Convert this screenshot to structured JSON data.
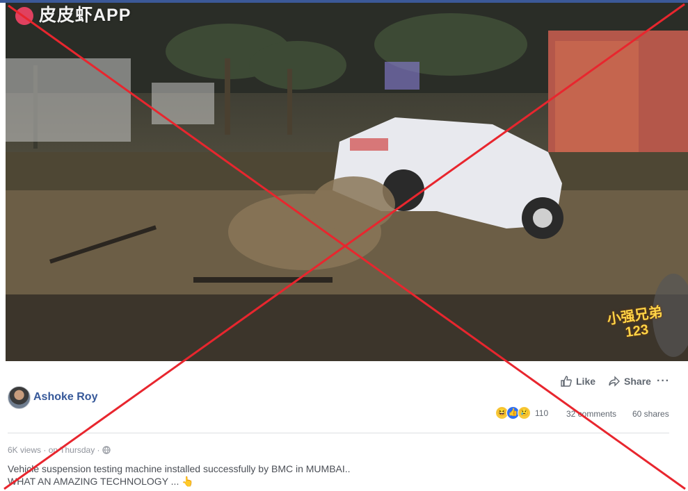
{
  "watermark": {
    "text": "皮皮虾APP"
  },
  "channel_tag": {
    "line1": "小强兄弟",
    "line2": "123"
  },
  "post": {
    "author": "Ashoke Roy",
    "actions": {
      "like": "Like",
      "share": "Share",
      "more": "···"
    },
    "reactions": {
      "count": "110",
      "types": [
        "haha-icon",
        "like-icon",
        "sad-icon"
      ]
    },
    "comments": "32 comments",
    "shares": "60 shares",
    "meta": {
      "views": "6K views",
      "separator": " · ",
      "time": "on Thursday",
      "separator2": " · "
    },
    "caption": {
      "line1": "Vehicle suspension testing machine installed successfully by BMC in MUMBAI..",
      "line2": "WHAT AN AMAZING TECHNOLOGY ... 👆"
    }
  },
  "colors": {
    "facebook_blue": "#3b5998",
    "link_blue": "#365899",
    "cross_red": "#e8262e",
    "muted": "#90949c"
  }
}
